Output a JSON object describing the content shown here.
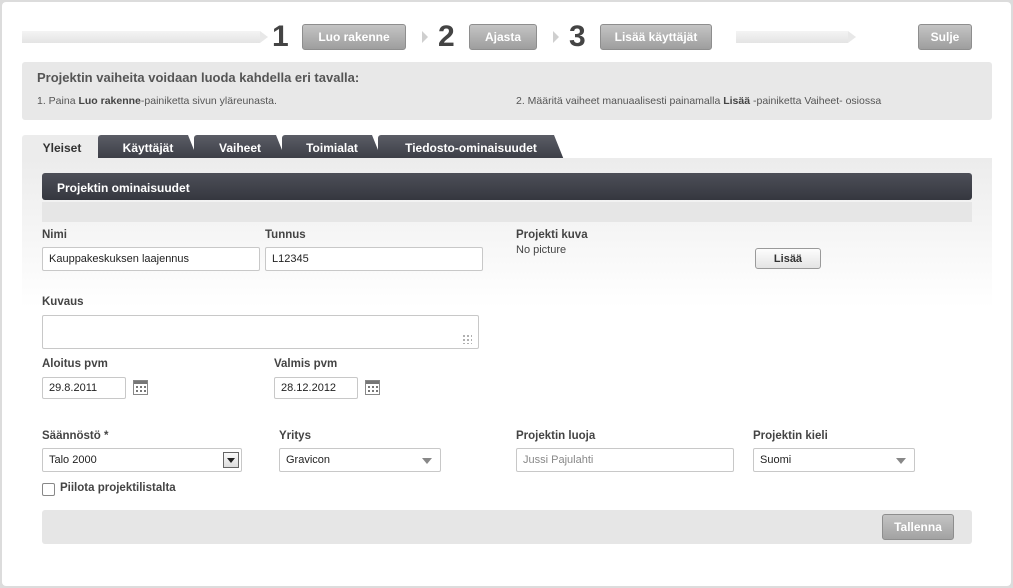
{
  "wizard": {
    "steps": [
      {
        "number": "1",
        "label": "Luo rakenne"
      },
      {
        "number": "2",
        "label": "Ajasta"
      },
      {
        "number": "3",
        "label": "Lisää käyttäjät"
      }
    ],
    "close_label": "Sulje"
  },
  "info": {
    "title": "Projektin vaiheita voidaan luoda kahdella eri tavalla:",
    "step1_pre": "1. Paina ",
    "step1_bold": "Luo rakenne",
    "step1_post": "-painiketta sivun yläreunasta.",
    "step2_pre": "2. Määritä vaiheet manuaalisesti painamalla ",
    "step2_bold": "Lisää",
    "step2_post": " -painiketta Vaiheet- osiossa"
  },
  "tabs": [
    "Yleiset",
    "Käyttäjät",
    "Vaiheet",
    "Toimialat",
    "Tiedosto-ominaisuudet"
  ],
  "form": {
    "section_title": "Projektin ominaisuudet",
    "name_label": "Nimi",
    "name_value": "Kauppakeskuksen laajennus",
    "code_label": "Tunnus",
    "code_value": "L12345",
    "picture_label": "Projekti kuva",
    "picture_value": "No picture",
    "picture_add": "Lisää",
    "desc_label": "Kuvaus",
    "desc_value": "",
    "start_label": "Aloitus pvm",
    "start_value": "29.8.2011",
    "end_label": "Valmis pvm",
    "end_value": "28.12.2012",
    "rules_label": "Säännöstö *",
    "rules_value": "Talo 2000",
    "company_label": "Yritys",
    "company_value": "Gravicon",
    "creator_label": "Projektin luoja",
    "creator_value": "Jussi Pajulahti",
    "language_label": "Projektin kieli",
    "language_value": "Suomi",
    "hide_label": "Piilota projektilistalta",
    "save_label": "Tallenna"
  }
}
